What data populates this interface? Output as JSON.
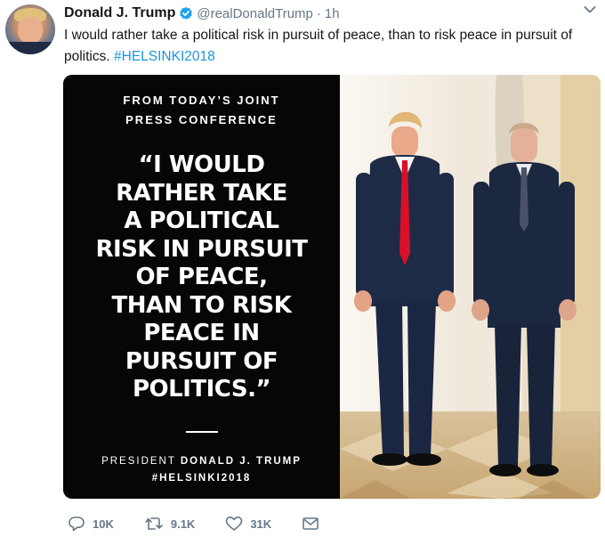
{
  "tweet": {
    "author_name": "Donald J. Trump",
    "handle": "@realDonaldTrump",
    "separator": "·",
    "time": "1h",
    "text": "I would rather take a political risk in pursuit of peace, than to risk peace in pursuit of politics. ",
    "hashtag": "#HELSINKI2018"
  },
  "card": {
    "kicker_line1": "FROM TODAY’S JOINT",
    "kicker_line2": "PRESS CONFERENCE",
    "quote_lines": [
      "“I WOULD",
      "RATHER TAKE",
      "A POLITICAL",
      "RISK IN PURSUIT",
      "OF PEACE,",
      "THAN TO RISK",
      "PEACE IN",
      "PURSUIT OF",
      "POLITICS.”"
    ],
    "attr_prefix": "PRESIDENT ",
    "attr_name": "DONALD J. TRUMP",
    "attr_hashtag": "#HELSINKI2018"
  },
  "actions": {
    "replies": "10K",
    "retweets": "9.1K",
    "likes": "31K"
  },
  "colors": {
    "link": "#1b95e0",
    "verified": "#1da1f2",
    "muted": "#657786"
  },
  "icons": [
    "verified-badge-icon",
    "chevron-down-icon",
    "reply-icon",
    "retweet-icon",
    "like-icon",
    "message-icon"
  ]
}
